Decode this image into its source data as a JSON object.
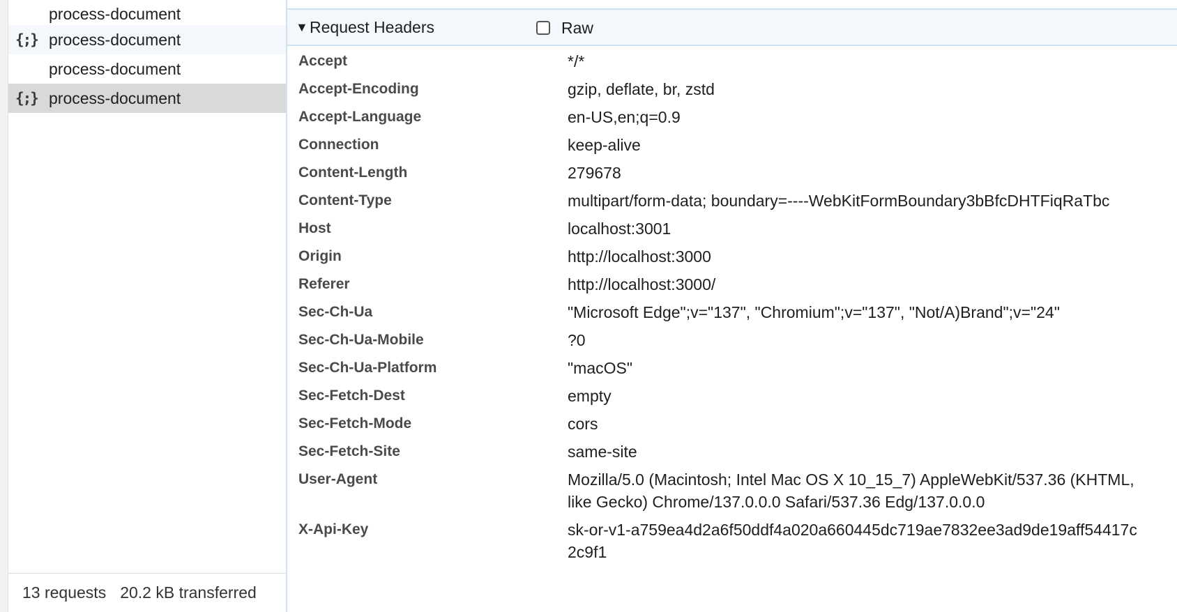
{
  "requests": [
    {
      "name": "process-document",
      "icon": "",
      "state": "normal"
    },
    {
      "name": "process-document",
      "icon": "{;}",
      "state": "alt"
    },
    {
      "name": "process-document",
      "icon": "",
      "state": "normal"
    },
    {
      "name": "process-document",
      "icon": "{;}",
      "state": "selected"
    }
  ],
  "footer": {
    "requests": "13 requests",
    "transferred": "20.2 kB transferred"
  },
  "section": {
    "disclosure": "▼",
    "title": "Request Headers",
    "raw_label": "Raw"
  },
  "headers": [
    {
      "name": "Accept",
      "value": "*/*"
    },
    {
      "name": "Accept-Encoding",
      "value": "gzip, deflate, br, zstd"
    },
    {
      "name": "Accept-Language",
      "value": "en-US,en;q=0.9"
    },
    {
      "name": "Connection",
      "value": "keep-alive"
    },
    {
      "name": "Content-Length",
      "value": "279678"
    },
    {
      "name": "Content-Type",
      "value": "multipart/form-data; boundary=----WebKitFormBoundary3bBfcDHTFiqRaTbc"
    },
    {
      "name": "Host",
      "value": "localhost:3001"
    },
    {
      "name": "Origin",
      "value": "http://localhost:3000"
    },
    {
      "name": "Referer",
      "value": "http://localhost:3000/"
    },
    {
      "name": "Sec-Ch-Ua",
      "value": "\"Microsoft Edge\";v=\"137\", \"Chromium\";v=\"137\", \"Not/A)Brand\";v=\"24\""
    },
    {
      "name": "Sec-Ch-Ua-Mobile",
      "value": "?0"
    },
    {
      "name": "Sec-Ch-Ua-Platform",
      "value": "\"macOS\""
    },
    {
      "name": "Sec-Fetch-Dest",
      "value": "empty"
    },
    {
      "name": "Sec-Fetch-Mode",
      "value": "cors"
    },
    {
      "name": "Sec-Fetch-Site",
      "value": "same-site"
    },
    {
      "name": "User-Agent",
      "value": "Mozilla/5.0 (Macintosh; Intel Mac OS X 10_15_7) AppleWebKit/537.36 (KHTML, like Gecko) Chrome/137.0.0.0 Safari/537.36 Edg/137.0.0.0"
    },
    {
      "name": "X-Api-Key",
      "value": "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"
    }
  ]
}
